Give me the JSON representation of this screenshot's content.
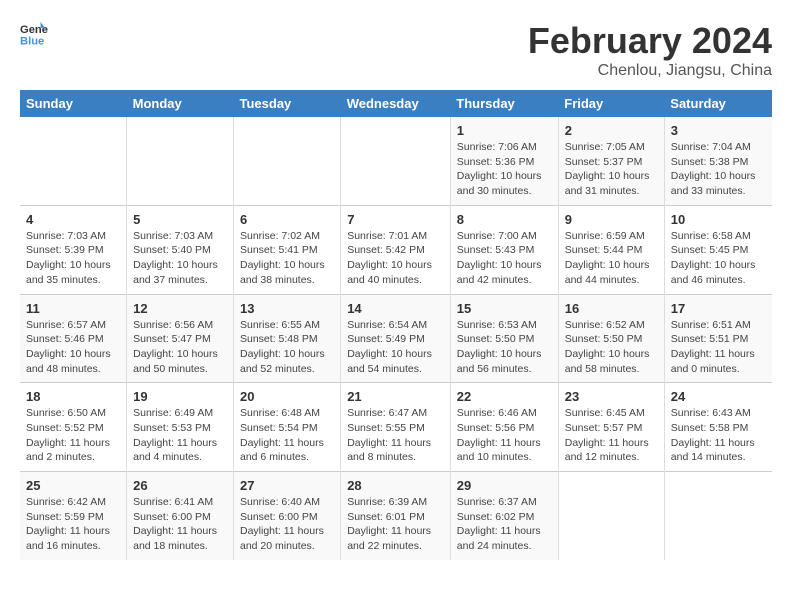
{
  "header": {
    "logo_line1": "General",
    "logo_line2": "Blue",
    "month_title": "February 2024",
    "subtitle": "Chenlou, Jiangsu, China"
  },
  "weekdays": [
    "Sunday",
    "Monday",
    "Tuesday",
    "Wednesday",
    "Thursday",
    "Friday",
    "Saturday"
  ],
  "weeks": [
    [
      {
        "day": "",
        "detail": ""
      },
      {
        "day": "",
        "detail": ""
      },
      {
        "day": "",
        "detail": ""
      },
      {
        "day": "",
        "detail": ""
      },
      {
        "day": "1",
        "detail": "Sunrise: 7:06 AM\nSunset: 5:36 PM\nDaylight: 10 hours\nand 30 minutes."
      },
      {
        "day": "2",
        "detail": "Sunrise: 7:05 AM\nSunset: 5:37 PM\nDaylight: 10 hours\nand 31 minutes."
      },
      {
        "day": "3",
        "detail": "Sunrise: 7:04 AM\nSunset: 5:38 PM\nDaylight: 10 hours\nand 33 minutes."
      }
    ],
    [
      {
        "day": "4",
        "detail": "Sunrise: 7:03 AM\nSunset: 5:39 PM\nDaylight: 10 hours\nand 35 minutes."
      },
      {
        "day": "5",
        "detail": "Sunrise: 7:03 AM\nSunset: 5:40 PM\nDaylight: 10 hours\nand 37 minutes."
      },
      {
        "day": "6",
        "detail": "Sunrise: 7:02 AM\nSunset: 5:41 PM\nDaylight: 10 hours\nand 38 minutes."
      },
      {
        "day": "7",
        "detail": "Sunrise: 7:01 AM\nSunset: 5:42 PM\nDaylight: 10 hours\nand 40 minutes."
      },
      {
        "day": "8",
        "detail": "Sunrise: 7:00 AM\nSunset: 5:43 PM\nDaylight: 10 hours\nand 42 minutes."
      },
      {
        "day": "9",
        "detail": "Sunrise: 6:59 AM\nSunset: 5:44 PM\nDaylight: 10 hours\nand 44 minutes."
      },
      {
        "day": "10",
        "detail": "Sunrise: 6:58 AM\nSunset: 5:45 PM\nDaylight: 10 hours\nand 46 minutes."
      }
    ],
    [
      {
        "day": "11",
        "detail": "Sunrise: 6:57 AM\nSunset: 5:46 PM\nDaylight: 10 hours\nand 48 minutes."
      },
      {
        "day": "12",
        "detail": "Sunrise: 6:56 AM\nSunset: 5:47 PM\nDaylight: 10 hours\nand 50 minutes."
      },
      {
        "day": "13",
        "detail": "Sunrise: 6:55 AM\nSunset: 5:48 PM\nDaylight: 10 hours\nand 52 minutes."
      },
      {
        "day": "14",
        "detail": "Sunrise: 6:54 AM\nSunset: 5:49 PM\nDaylight: 10 hours\nand 54 minutes."
      },
      {
        "day": "15",
        "detail": "Sunrise: 6:53 AM\nSunset: 5:50 PM\nDaylight: 10 hours\nand 56 minutes."
      },
      {
        "day": "16",
        "detail": "Sunrise: 6:52 AM\nSunset: 5:50 PM\nDaylight: 10 hours\nand 58 minutes."
      },
      {
        "day": "17",
        "detail": "Sunrise: 6:51 AM\nSunset: 5:51 PM\nDaylight: 11 hours\nand 0 minutes."
      }
    ],
    [
      {
        "day": "18",
        "detail": "Sunrise: 6:50 AM\nSunset: 5:52 PM\nDaylight: 11 hours\nand 2 minutes."
      },
      {
        "day": "19",
        "detail": "Sunrise: 6:49 AM\nSunset: 5:53 PM\nDaylight: 11 hours\nand 4 minutes."
      },
      {
        "day": "20",
        "detail": "Sunrise: 6:48 AM\nSunset: 5:54 PM\nDaylight: 11 hours\nand 6 minutes."
      },
      {
        "day": "21",
        "detail": "Sunrise: 6:47 AM\nSunset: 5:55 PM\nDaylight: 11 hours\nand 8 minutes."
      },
      {
        "day": "22",
        "detail": "Sunrise: 6:46 AM\nSunset: 5:56 PM\nDaylight: 11 hours\nand 10 minutes."
      },
      {
        "day": "23",
        "detail": "Sunrise: 6:45 AM\nSunset: 5:57 PM\nDaylight: 11 hours\nand 12 minutes."
      },
      {
        "day": "24",
        "detail": "Sunrise: 6:43 AM\nSunset: 5:58 PM\nDaylight: 11 hours\nand 14 minutes."
      }
    ],
    [
      {
        "day": "25",
        "detail": "Sunrise: 6:42 AM\nSunset: 5:59 PM\nDaylight: 11 hours\nand 16 minutes."
      },
      {
        "day": "26",
        "detail": "Sunrise: 6:41 AM\nSunset: 6:00 PM\nDaylight: 11 hours\nand 18 minutes."
      },
      {
        "day": "27",
        "detail": "Sunrise: 6:40 AM\nSunset: 6:00 PM\nDaylight: 11 hours\nand 20 minutes."
      },
      {
        "day": "28",
        "detail": "Sunrise: 6:39 AM\nSunset: 6:01 PM\nDaylight: 11 hours\nand 22 minutes."
      },
      {
        "day": "29",
        "detail": "Sunrise: 6:37 AM\nSunset: 6:02 PM\nDaylight: 11 hours\nand 24 minutes."
      },
      {
        "day": "",
        "detail": ""
      },
      {
        "day": "",
        "detail": ""
      }
    ]
  ]
}
